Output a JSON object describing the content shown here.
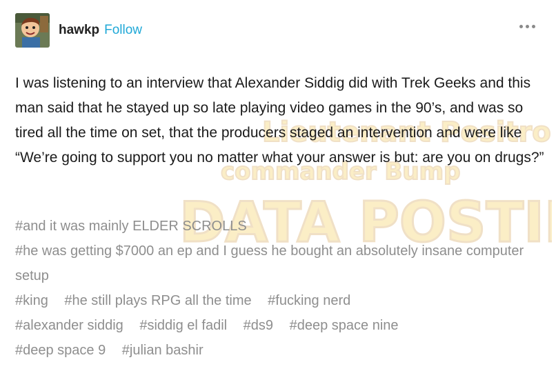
{
  "post": {
    "author": "hawkp",
    "follow_label": "Follow",
    "body": "I was listening to an interview that Alexander Siddig did with Trek Geeks and this man said that he stayed up so late playing video games in the 90’s, and was so tired all the time on set, that the producers staged an intervention and were like “We’re going to support you no matter what your answer is but: are you on drugs?”",
    "tags": [
      "#and it was mainly ELDER SCROLLS",
      "#he was getting $7000 an ep and I guess he bought an absolutely insane computer setup",
      "#king",
      "#he still plays RPG all the time",
      "#fucking nerd",
      "#alexander siddig",
      "#siddig el fadil",
      "#ds9",
      "#deep space nine",
      "#deep space 9",
      "#julian bashir"
    ]
  },
  "icons": {
    "avatar": "avatar-cartoon-icon",
    "more": "more-options-icon"
  },
  "colors": {
    "follow": "#1fa8d7",
    "tags": "#8e8e8e",
    "text": "#1a1a1a"
  }
}
